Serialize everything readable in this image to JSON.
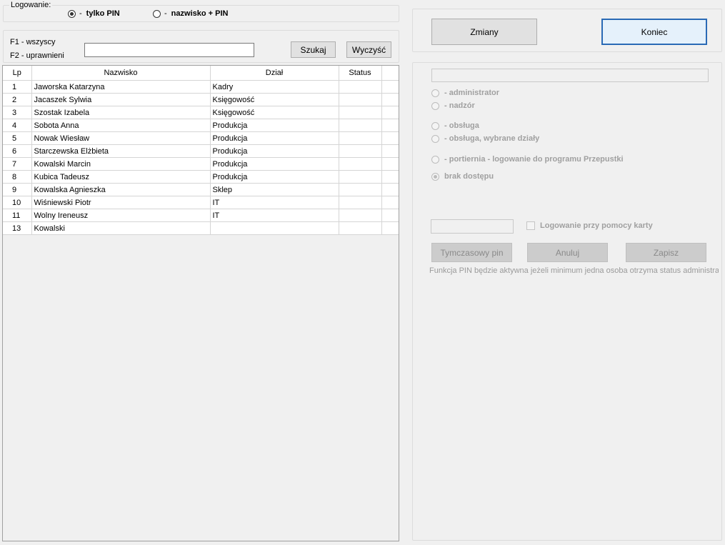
{
  "login": {
    "legend": "Logowanie:",
    "options": [
      {
        "dash": "-",
        "label": "tylko PIN",
        "checked": true
      },
      {
        "dash": "-",
        "label": "nazwisko + PIN",
        "checked": false
      }
    ]
  },
  "search": {
    "hint1": "F1 - wszyscy",
    "hint2": "F2 - uprawnieni",
    "value": "",
    "search_label": "Szukaj",
    "clear_label": "Wyczyść"
  },
  "table": {
    "columns": [
      "Lp",
      "Nazwisko",
      "Dział",
      "Status",
      ""
    ],
    "rows": [
      {
        "lp": "1",
        "name": "Jaworska Katarzyna",
        "dept": "Kadry",
        "status": ""
      },
      {
        "lp": "2",
        "name": "Jacaszek Sylwia",
        "dept": "Księgowość",
        "status": ""
      },
      {
        "lp": "3",
        "name": "Szostak Izabela",
        "dept": "Księgowość",
        "status": ""
      },
      {
        "lp": "4",
        "name": "Sobota Anna",
        "dept": "Produkcja",
        "status": ""
      },
      {
        "lp": "5",
        "name": "Nowak Wiesław",
        "dept": "Produkcja",
        "status": ""
      },
      {
        "lp": "6",
        "name": "Starczewska Elżbieta",
        "dept": "Produkcja",
        "status": ""
      },
      {
        "lp": "7",
        "name": "Kowalski Marcin",
        "dept": "Produkcja",
        "status": ""
      },
      {
        "lp": "8",
        "name": "Kubica Tadeusz",
        "dept": "Produkcja",
        "status": ""
      },
      {
        "lp": "9",
        "name": "Kowalska Agnieszka",
        "dept": "Sklep",
        "status": ""
      },
      {
        "lp": "10",
        "name": "Wiśniewski Piotr",
        "dept": "IT",
        "status": ""
      },
      {
        "lp": "11",
        "name": "Wolny Ireneusz",
        "dept": "IT",
        "status": ""
      },
      {
        "lp": "13",
        "name": "Kowalski",
        "dept": "",
        "status": ""
      }
    ]
  },
  "actions": {
    "changes_label": "Zmiany",
    "end_label": "Koniec"
  },
  "permissions": {
    "name_value": "",
    "options": [
      {
        "text": "-  administrator",
        "checked": false
      },
      {
        "text": "-  nadzór",
        "checked": false
      },
      {
        "text": "-  obsługa",
        "checked": false
      },
      {
        "text": "-  obsługa, wybrane działy",
        "checked": false
      },
      {
        "text": "-  portiernia  -  logowanie do programu Przepustki",
        "checked": false
      },
      {
        "text": "brak dostępu",
        "checked": true
      }
    ],
    "card_value": "",
    "card_label": "Logowanie przy pomocy karty",
    "temp_pin_label": "Tymczasowy pin",
    "cancel_label": "Anuluj",
    "save_label": "Zapisz",
    "note": "Funkcja PIN będzie aktywna jeżeli minimum jedna osoba otrzyma status administrator"
  }
}
